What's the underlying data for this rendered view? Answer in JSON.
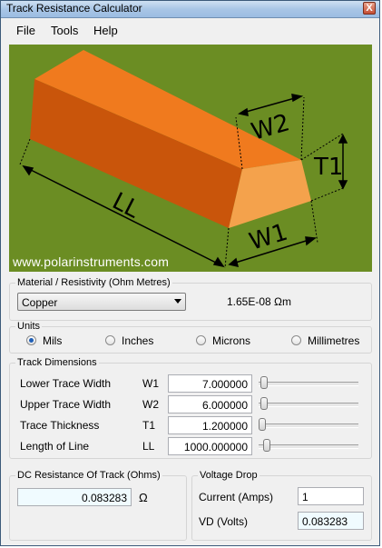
{
  "window": {
    "title": "Track Resistance Calculator",
    "close_glyph": "X"
  },
  "menu": [
    {
      "label": "File"
    },
    {
      "label": "Tools"
    },
    {
      "label": "Help"
    }
  ],
  "hero": {
    "url": "www.polarinstruments.com",
    "labels": {
      "ll": "LL",
      "w1": "W1",
      "w2": "W2",
      "t1": "T1"
    },
    "colors": {
      "background": "#6b8d23",
      "track_top": "#f07a1e",
      "track_front": "#c9550b",
      "track_side": "#f4a24c"
    }
  },
  "material": {
    "group_label": "Material / Resistivity (Ohm Metres)",
    "selected": "Copper",
    "resistivity": "1.65E-08 Ωm"
  },
  "units": {
    "group_label": "Units",
    "options": [
      {
        "label": "Mils",
        "selected": true
      },
      {
        "label": "Inches",
        "selected": false
      },
      {
        "label": "Microns",
        "selected": false
      },
      {
        "label": "Millimetres",
        "selected": false
      }
    ]
  },
  "dimensions": {
    "group_label": "Track Dimensions",
    "rows": [
      {
        "label": "Lower Trace Width",
        "symbol": "W1",
        "value": "7.000000",
        "slider_fraction": 0.02
      },
      {
        "label": "Upper Trace Width",
        "symbol": "W2",
        "value": "6.000000",
        "slider_fraction": 0.02
      },
      {
        "label": "Trace Thickness",
        "symbol": "T1",
        "value": "1.200000",
        "slider_fraction": 0.0
      },
      {
        "label": "Length of Line",
        "symbol": "LL",
        "value": "1000.000000",
        "slider_fraction": 0.05
      }
    ]
  },
  "dc_resistance": {
    "group_label": "DC Resistance Of Track (Ohms)",
    "value": "0.083283",
    "unit": "Ω"
  },
  "voltage_drop": {
    "group_label": "Voltage Drop",
    "current_label": "Current (Amps)",
    "current_value": "1",
    "vd_label": "VD (Volts)",
    "vd_value": "0.083283"
  }
}
